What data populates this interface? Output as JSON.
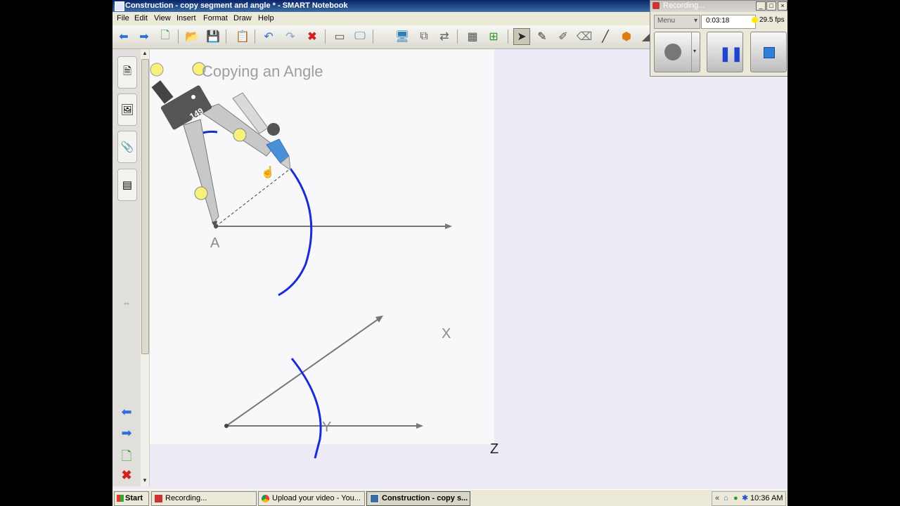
{
  "window": {
    "title": "Construction - copy segment and angle * - SMART Notebook"
  },
  "menu": [
    "File",
    "Edit",
    "View",
    "Insert",
    "Format",
    "Draw",
    "Help"
  ],
  "toolbar": {
    "icons": [
      "back-arrow-icon",
      "forward-arrow-icon",
      "add-page-icon",
      "open-folder-icon",
      "save-icon",
      "paste-icon",
      "undo-icon",
      "redo-icon",
      "delete-icon",
      "screen-shade-icon",
      "full-screen-icon",
      "display-icon",
      "capture-icon",
      "dual-page-icon",
      "table-icon",
      "insert-icon",
      "select-icon",
      "pen-icon",
      "creative-pen-icon",
      "eraser-icon",
      "line-icon",
      "shape-icon",
      "fill-icon"
    ]
  },
  "sidebar": {
    "tabs": [
      "page-sorter-icon",
      "gallery-icon",
      "attachments-icon",
      "properties-icon"
    ]
  },
  "canvas": {
    "title": "Copying an Angle",
    "compass_label": "149",
    "points": {
      "a": "A",
      "x": "X",
      "y": "Y",
      "z": "Z"
    }
  },
  "recorder": {
    "title": "Recording...",
    "menu_label": "Menu",
    "time": "0:03:18",
    "fps": "29.5 fps"
  },
  "taskbar": {
    "start": "Start",
    "tasks": [
      {
        "label": "Recording..."
      },
      {
        "label": "Upload your video - You..."
      },
      {
        "label": "Construction - copy s...",
        "active": true
      }
    ],
    "clock": "10:36 AM"
  },
  "colors": {
    "arc": "#1a2ad6",
    "compass_pivot": "#555555",
    "nib": "#4a90d9"
  }
}
